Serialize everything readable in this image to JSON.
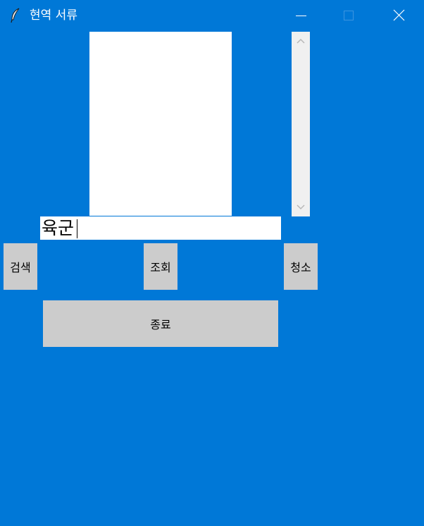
{
  "window": {
    "title": "현역 서류",
    "icon": "feather-icon",
    "controls": [
      "minimize-icon",
      "maximize-icon",
      "close-icon"
    ]
  },
  "listbox": {
    "items": []
  },
  "scrollbar": {
    "up_icon": "chevron-up-icon",
    "down_icon": "chevron-down-icon"
  },
  "entry": {
    "value": "육군"
  },
  "buttons": {
    "search": "검색",
    "view": "조회",
    "clear": "청소",
    "exit": "종료"
  },
  "colors": {
    "background": "#0078d7",
    "button": "#cccccc",
    "scrollbar": "#f0f0f0"
  }
}
